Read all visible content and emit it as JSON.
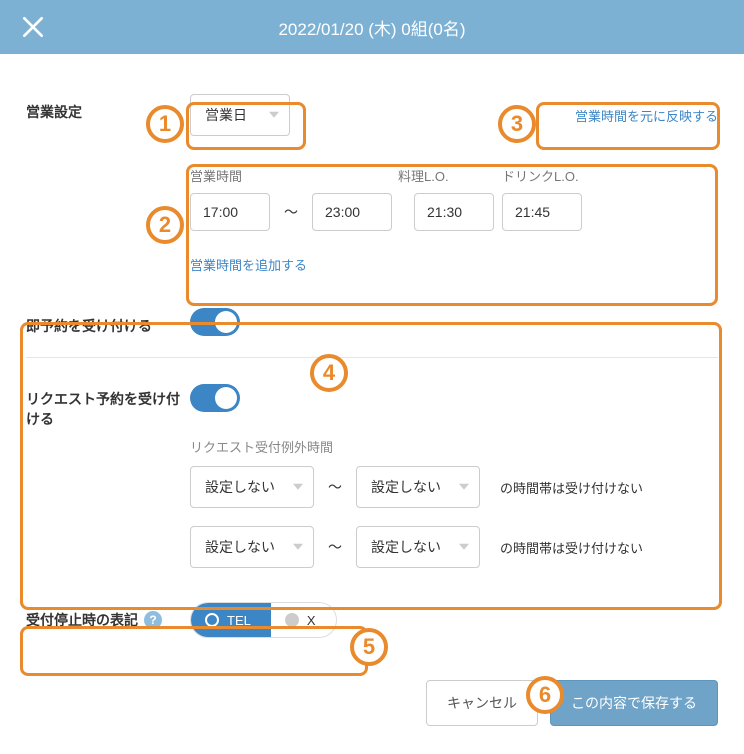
{
  "header": {
    "title": "2022/01/20 (木) 0組(0名)"
  },
  "sections": {
    "businessSetting": {
      "label": "営業設定",
      "statusSelect": "営業日",
      "reflectLink": "営業時間を元に反映する"
    },
    "hours": {
      "headers": {
        "business": "営業時間",
        "foodLO": "料理L.O.",
        "drinkLO": "ドリンクL.O."
      },
      "start": "17:00",
      "end": "23:00",
      "foodLO": "21:30",
      "drinkLO": "21:45",
      "tilde": "〜",
      "addLink": "営業時間を追加する"
    },
    "instant": {
      "label": "即予約を受け付ける"
    },
    "request": {
      "label": "リクエスト予約を受け付ける",
      "subhead": "リクエスト受付例外時間",
      "none": "設定しない",
      "tilde": "〜",
      "note": "の時間帯は受け付けない"
    },
    "stop": {
      "label": "受付停止時の表記",
      "help": "?",
      "optTel": "TEL",
      "optX": "X"
    }
  },
  "footer": {
    "cancel": "キャンセル",
    "save": "この内容で保存する"
  },
  "annotations": {
    "n1": "1",
    "n2": "2",
    "n3": "3",
    "n4": "4",
    "n5": "5",
    "n6": "6"
  }
}
